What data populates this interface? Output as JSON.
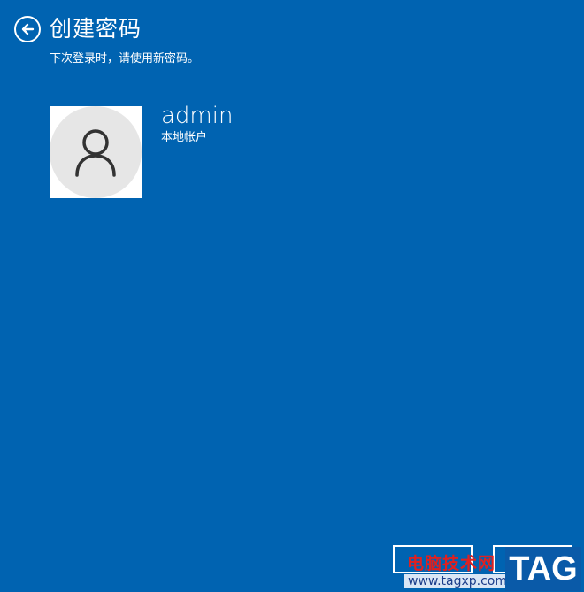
{
  "header": {
    "title": "创建密码",
    "subtitle": "下次登录时，请使用新密码。"
  },
  "account": {
    "username": "admin",
    "type": "本地帐户"
  },
  "watermark": {
    "site_name": "电脑技术网",
    "url": "www.tagxp.com",
    "tag": "TAG"
  },
  "colors": {
    "background": "#0063b1",
    "text": "#ffffff",
    "avatar_bg": "#e6e6e6"
  }
}
